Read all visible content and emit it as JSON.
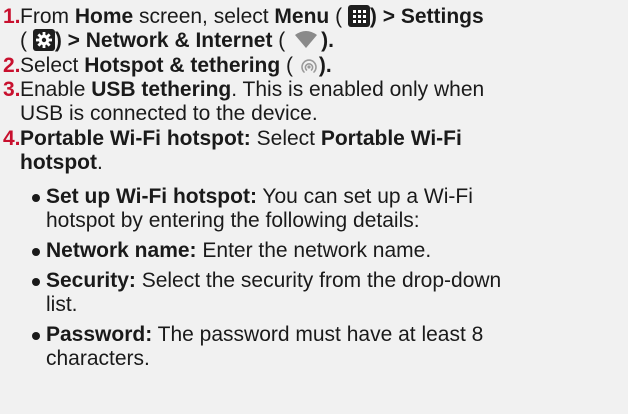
{
  "steps": [
    {
      "number": "1.",
      "lines": [
        [
          "From ",
          "Home",
          " screen, select ",
          "Menu",
          " ( ",
          ") > Settings"
        ],
        [
          "( ",
          ") > Network & Internet",
          " ( ",
          ")."
        ]
      ]
    },
    {
      "number": "2.",
      "lines": [
        [
          "Select ",
          "Hotspot & tethering",
          " ( ",
          ")."
        ]
      ]
    },
    {
      "number": "3.",
      "lines": [
        [
          "Enable ",
          "USB tethering",
          ". This is enabled only when"
        ],
        [
          "USB is connected to the device."
        ]
      ]
    },
    {
      "number": "4.",
      "lines": [
        [
          "Portable Wi-Fi hotspot:",
          " Select ",
          "Portable Wi-Fi"
        ],
        [
          "hotspot",
          "."
        ]
      ]
    }
  ],
  "bullets": [
    {
      "lines": [
        [
          "Set up Wi-Fi hotspot:",
          " You can set up a Wi-Fi"
        ],
        [
          "hotspot by entering the following details:"
        ]
      ]
    },
    {
      "lines": [
        [
          "Network name:",
          " Enter the network name."
        ]
      ]
    },
    {
      "lines": [
        [
          "Security:",
          " Select the security from the drop-down"
        ],
        [
          "list."
        ]
      ]
    },
    {
      "lines": [
        [
          "Password:",
          " The password must have at least 8"
        ],
        [
          "characters."
        ]
      ]
    }
  ],
  "icons": {
    "menu": "grid-menu-icon",
    "settings": "gear-icon",
    "network": "wifi-icon",
    "hotspot": "hotspot-icon"
  },
  "colors": {
    "step_number": "#c8102e",
    "text": "#1a1a1a",
    "background": "#f1f1f1",
    "icon_bg": "#1e1e1e"
  }
}
